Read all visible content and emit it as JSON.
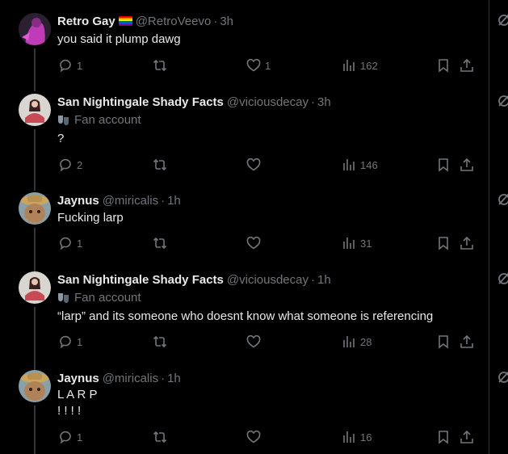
{
  "tweets": [
    {
      "name": "Retro Gay",
      "handle": "@RetroVeevo",
      "time": "3h",
      "label": "",
      "lines": [
        "you said it plump dawg"
      ],
      "replies": "1",
      "retweets": "",
      "likes": "1",
      "views": "162"
    },
    {
      "name": "San Nightingale Shady Facts",
      "handle": "@viciousdecay",
      "time": "3h",
      "label": "Fan account",
      "lines": [
        "?"
      ],
      "replies": "2",
      "retweets": "",
      "likes": "",
      "views": "146"
    },
    {
      "name": "Jaynus",
      "handle": "@miricalis",
      "time": "1h",
      "label": "",
      "lines": [
        "Fucking larp"
      ],
      "replies": "1",
      "retweets": "",
      "likes": "",
      "views": "31"
    },
    {
      "name": "San Nightingale Shady Facts",
      "handle": "@viciousdecay",
      "time": "1h",
      "label": "Fan account",
      "lines": [
        "“larp” and its someone who doesnt know what someone is referencing"
      ],
      "replies": "1",
      "retweets": "",
      "likes": "",
      "views": "28"
    },
    {
      "name": "Jaynus",
      "handle": "@miricalis",
      "time": "1h",
      "label": "",
      "lines": [
        "L A R P",
        "! ! ! !"
      ],
      "replies": "1",
      "retweets": "",
      "likes": "",
      "views": "16"
    }
  ],
  "separator": "·",
  "icons": {
    "reply": "reply-icon",
    "retweet": "retweet-icon",
    "like": "heart-icon",
    "views": "views-icon",
    "bookmark": "bookmark-icon",
    "share": "share-icon",
    "grok": "grok-icon",
    "more": "more-icon",
    "fan": "fan-account-icon"
  },
  "colors": {
    "background": "#000000",
    "text": "#e7e9ea",
    "muted": "#71767b",
    "divider": "#2f3336"
  }
}
